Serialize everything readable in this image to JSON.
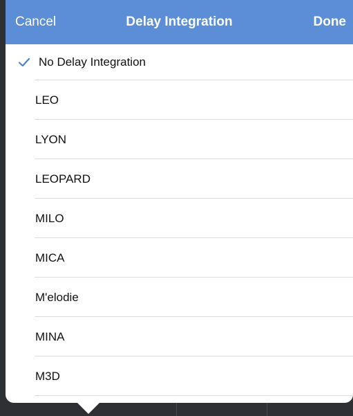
{
  "navbar": {
    "cancel_label": "Cancel",
    "title": "Delay Integration",
    "done_label": "Done"
  },
  "colors": {
    "navbar_bg": "#5b8ed6",
    "checkmark": "#4a82d0"
  },
  "list": {
    "selected_index": 0,
    "items": [
      {
        "label": "No Delay Integration",
        "checked": true
      },
      {
        "label": "LEO",
        "checked": false
      },
      {
        "label": "LYON",
        "checked": false
      },
      {
        "label": "LEOPARD",
        "checked": false
      },
      {
        "label": "MILO",
        "checked": false
      },
      {
        "label": "MICA",
        "checked": false
      },
      {
        "label": "M'elodie",
        "checked": false
      },
      {
        "label": "MINA",
        "checked": false
      },
      {
        "label": "M3D",
        "checked": false
      }
    ]
  }
}
